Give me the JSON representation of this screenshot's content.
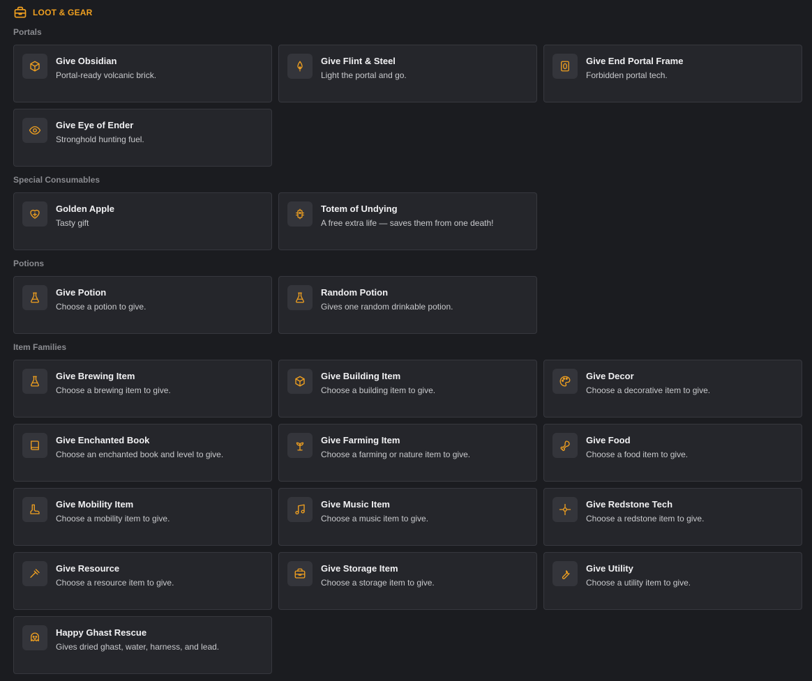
{
  "header": {
    "title": "LOOT & GEAR",
    "icon": "toolbox-icon",
    "accent": "#f0a020"
  },
  "sections": [
    {
      "label": "Portals",
      "cards": [
        {
          "title": "Give Obsidian",
          "desc": "Portal-ready volcanic brick.",
          "icon": "cube-icon"
        },
        {
          "title": "Give Flint & Steel",
          "desc": "Light the portal and go.",
          "icon": "flame-icon"
        },
        {
          "title": "Give End Portal Frame",
          "desc": "Forbidden portal tech.",
          "icon": "portal-frame-icon"
        },
        {
          "title": "Give Eye of Ender",
          "desc": "Stronghold hunting fuel.",
          "icon": "eye-icon"
        }
      ]
    },
    {
      "label": "Special Consumables",
      "cards": [
        {
          "title": "Golden Apple",
          "desc": "Tasty gift",
          "icon": "heart-plus-icon"
        },
        {
          "title": "Totem of Undying",
          "desc": "A free extra life — saves them from one death!",
          "icon": "totem-icon"
        }
      ]
    },
    {
      "label": "Potions",
      "cards": [
        {
          "title": "Give Potion",
          "desc": "Choose a potion to give.",
          "icon": "flask-icon"
        },
        {
          "title": "Random Potion",
          "desc": "Gives one random drinkable potion.",
          "icon": "flask-icon"
        }
      ]
    },
    {
      "label": "Item Families",
      "cards": [
        {
          "title": "Give Brewing Item",
          "desc": "Choose a brewing item to give.",
          "icon": "flask-icon"
        },
        {
          "title": "Give Building Item",
          "desc": "Choose a building item to give.",
          "icon": "cube-icon"
        },
        {
          "title": "Give Decor",
          "desc": "Choose a decorative item to give.",
          "icon": "palette-icon"
        },
        {
          "title": "Give Enchanted Book",
          "desc": "Choose an enchanted book and level to give.",
          "icon": "book-icon"
        },
        {
          "title": "Give Farming Item",
          "desc": "Choose a farming or nature item to give.",
          "icon": "sprout-icon"
        },
        {
          "title": "Give Food",
          "desc": "Choose a food item to give.",
          "icon": "drumstick-icon"
        },
        {
          "title": "Give Mobility Item",
          "desc": "Choose a mobility item to give.",
          "icon": "boot-icon"
        },
        {
          "title": "Give Music Item",
          "desc": "Choose a music item to give.",
          "icon": "music-icon"
        },
        {
          "title": "Give Redstone Tech",
          "desc": "Choose a redstone item to give.",
          "icon": "circuit-icon"
        },
        {
          "title": "Give Resource",
          "desc": "Choose a resource item to give.",
          "icon": "pickaxe-icon"
        },
        {
          "title": "Give Storage Item",
          "desc": "Choose a storage item to give.",
          "icon": "toolbox-icon"
        },
        {
          "title": "Give Utility",
          "desc": "Choose a utility item to give.",
          "icon": "wrench-icon"
        },
        {
          "title": "Happy Ghast Rescue",
          "desc": "Gives dried ghast, water, harness, and lead.",
          "icon": "ghast-icon"
        }
      ]
    }
  ]
}
